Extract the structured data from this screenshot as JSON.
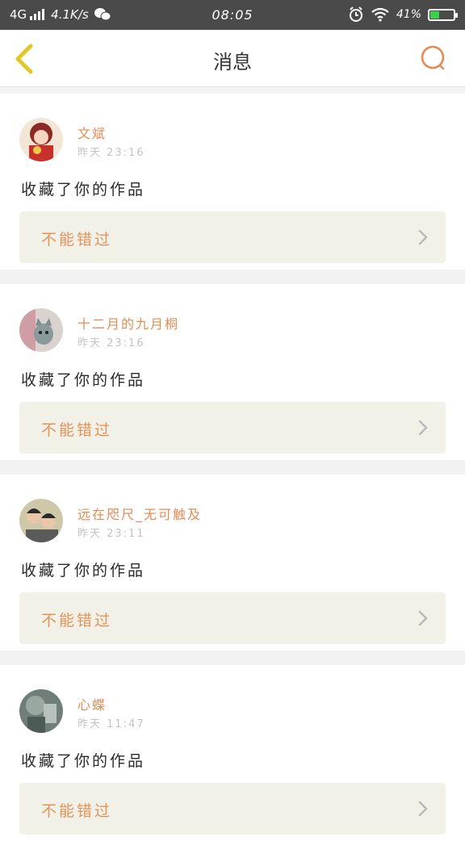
{
  "status_bar": {
    "network": "4G",
    "speed": "4.1K/s",
    "time": "08:05",
    "battery_percent": "41%",
    "battery_level": 0.41
  },
  "header": {
    "title": "消息",
    "back_icon": "chevron-left-icon",
    "search_icon": "search-icon"
  },
  "colors": {
    "accent": "#e38b54",
    "back": "#e3c72a",
    "promo_bg": "#f2f1e8"
  },
  "messages": [
    {
      "username": "文斌",
      "time": "昨天 23:16",
      "action": "收藏了你的作品",
      "promo": "不能错过",
      "avatar": "anime-avatar"
    },
    {
      "username": "十二月的九月桐",
      "time": "昨天 23:16",
      "action": "收藏了你的作品",
      "promo": "不能错过",
      "avatar": "cat-avatar"
    },
    {
      "username": "远在咫尺_无可触及",
      "time": "昨天 23:11",
      "action": "收藏了你的作品",
      "promo": "不能错过",
      "avatar": "group-photo-avatar"
    },
    {
      "username": "心蝶",
      "time": "昨天 11:47",
      "action": "收藏了你的作品",
      "promo": "不能错过",
      "avatar": "statue-avatar"
    }
  ]
}
